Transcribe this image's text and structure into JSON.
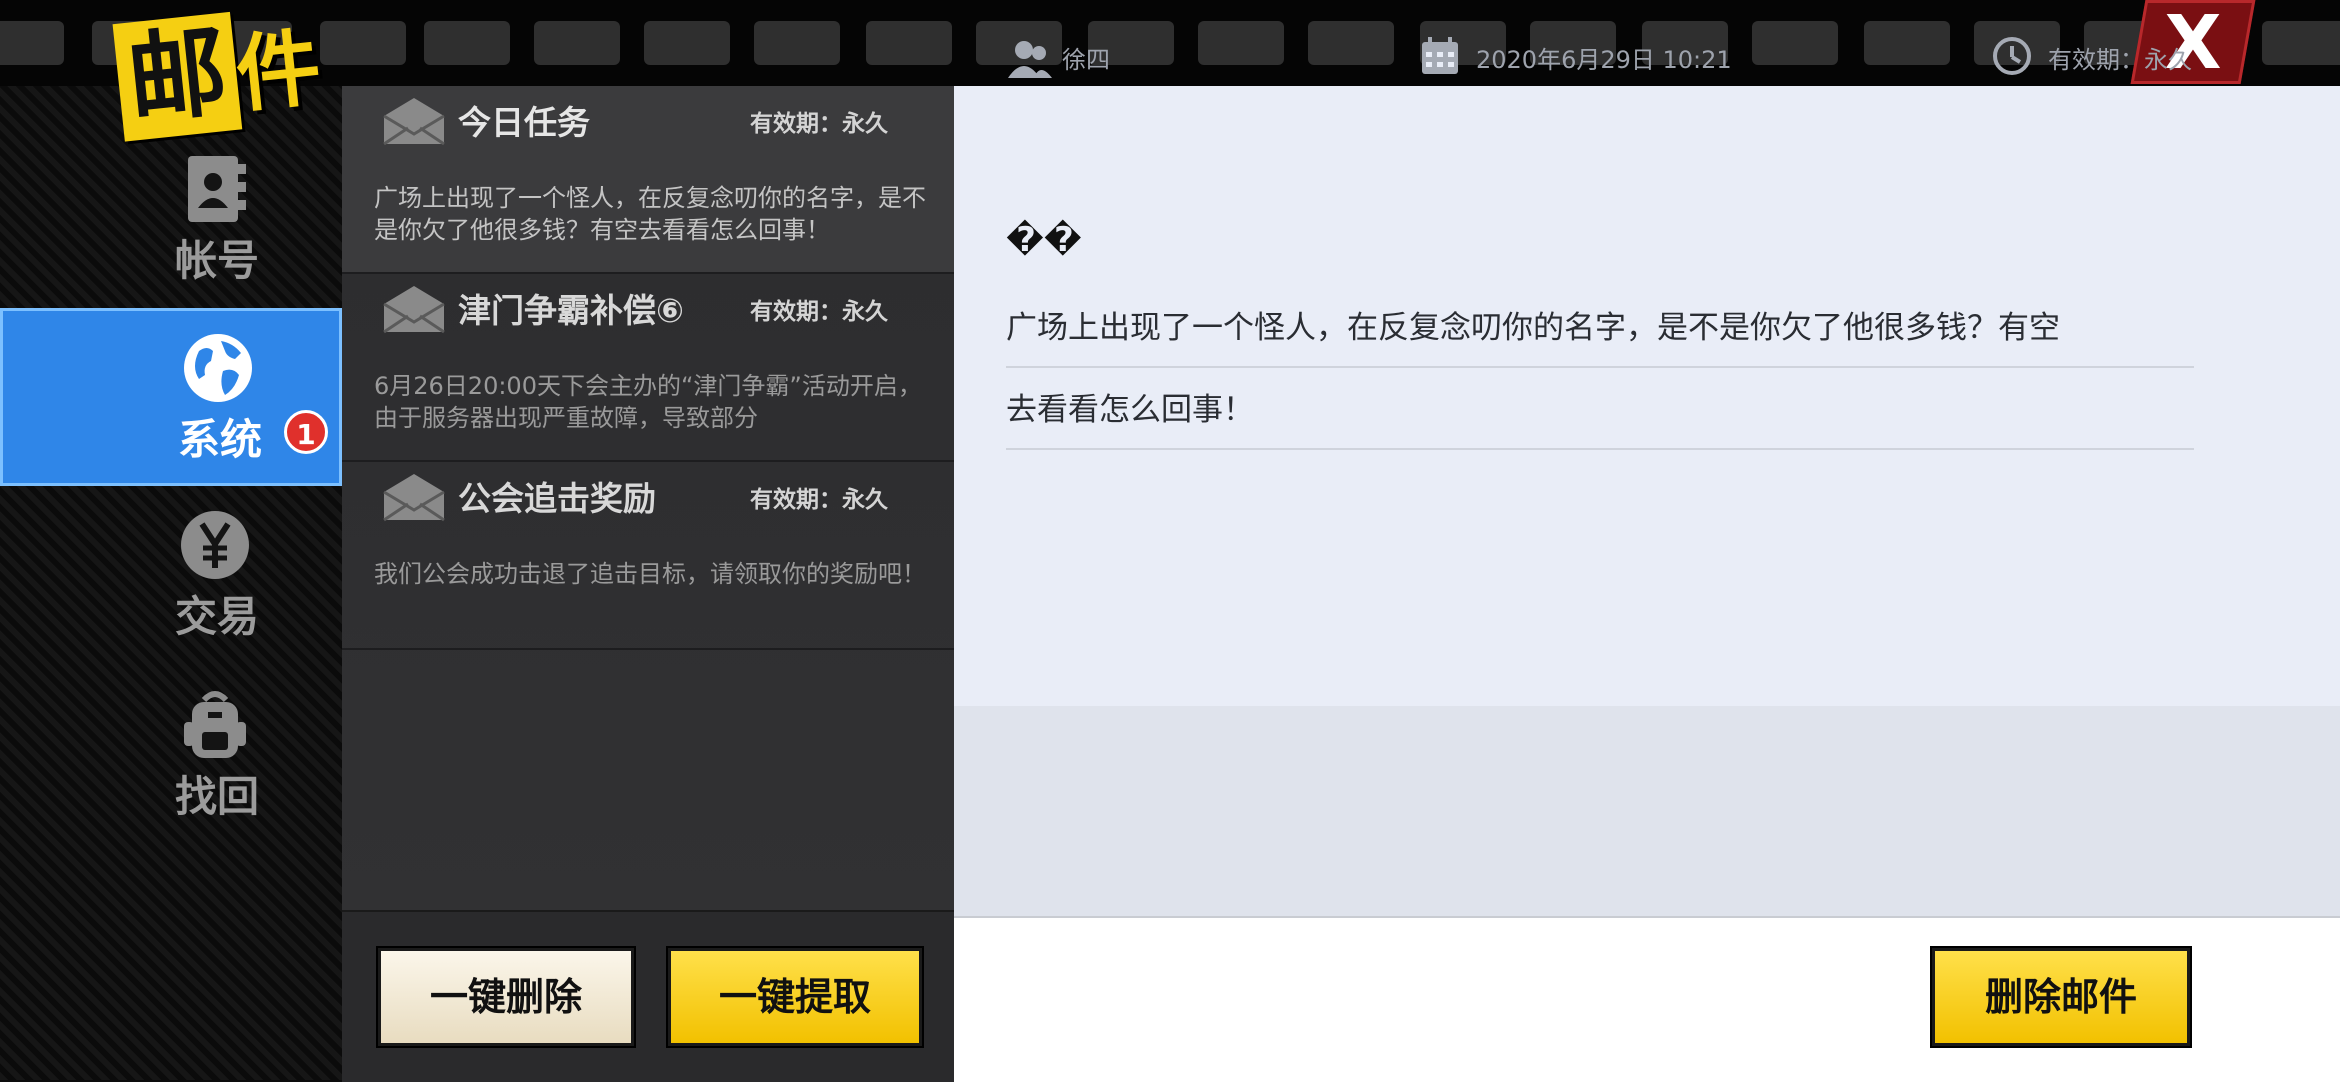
{
  "header": {
    "title_char1": "邮",
    "title_char2": "件",
    "close_label": "X"
  },
  "sidebar": {
    "items": [
      {
        "label": "帐号",
        "icon": "contact-book-icon"
      },
      {
        "label": "系统",
        "icon": "globe-icon"
      },
      {
        "label": "交易",
        "icon": "yen-coin-icon",
        "badge": "1"
      },
      {
        "label": "找回",
        "icon": "backpack-icon"
      }
    ]
  },
  "mail_list": {
    "items": [
      {
        "title": "今日任务",
        "validity": "有效期：永久",
        "preview": "广场上出现了一个怪人，在反复念叨你的名字，是不是你欠了他很多钱？有空去看看怎么回事！"
      },
      {
        "title": "津门争霸补偿⑥",
        "validity": "有效期：永久",
        "preview": "6月26日20:00天下会主办的“津门争霸”活动开启，由于服务器出现严重故障，导致部分"
      },
      {
        "title": "公会追击奖励",
        "validity": "有效期：永久",
        "preview": "我们公会成功击退了追击目标，请领取你的奖励吧！"
      }
    ],
    "delete_all_label": "一键删除",
    "claim_all_label": "一键提取"
  },
  "detail": {
    "sender": "徐四",
    "date": "2020年6月29日  10:21",
    "validity": "有效期：永久",
    "heading": "��",
    "line1": "广场上出现了一个怪人，在反复念叨你的名字，是不是你欠了他很多钱？有空",
    "line2": "去看看怎么回事！",
    "delete_label": "删除邮件"
  },
  "colors": {
    "accent_yellow": "#f5cf12",
    "active_blue": "#2f86e8",
    "badge_red": "#e0302c"
  }
}
